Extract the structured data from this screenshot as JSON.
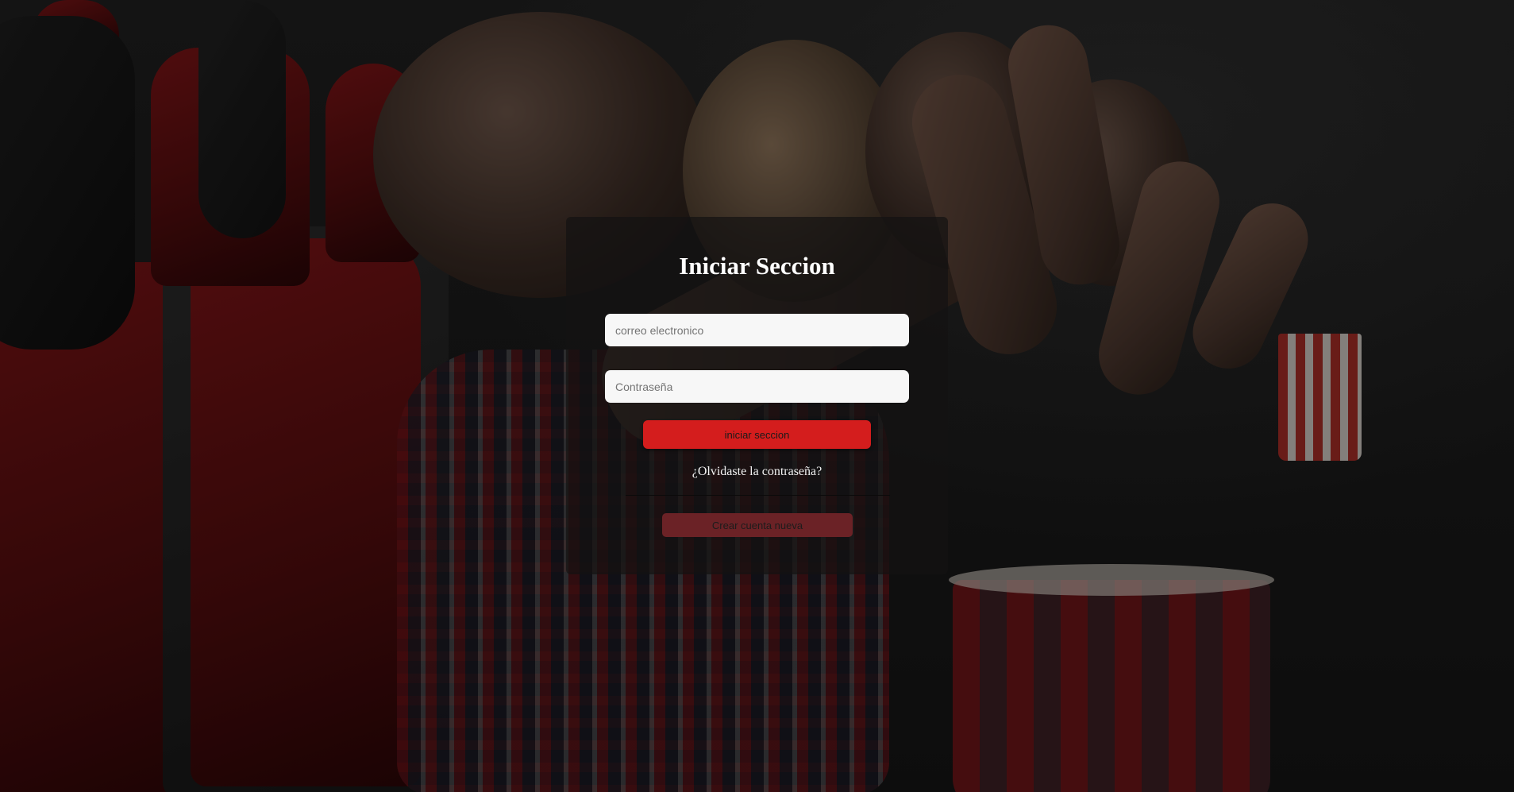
{
  "login": {
    "title": "Iniciar Seccion",
    "email_placeholder": "correo electronico",
    "password_placeholder": "Contraseña",
    "login_button": "iniciar seccion",
    "forgot_link": "¿Olvidaste la contraseña?",
    "create_button": "Crear cuenta nueva"
  },
  "colors": {
    "accent": "#d41d1d",
    "secondary_button": "#6b2226",
    "card_background": "rgba(20,18,18,0.72)"
  }
}
